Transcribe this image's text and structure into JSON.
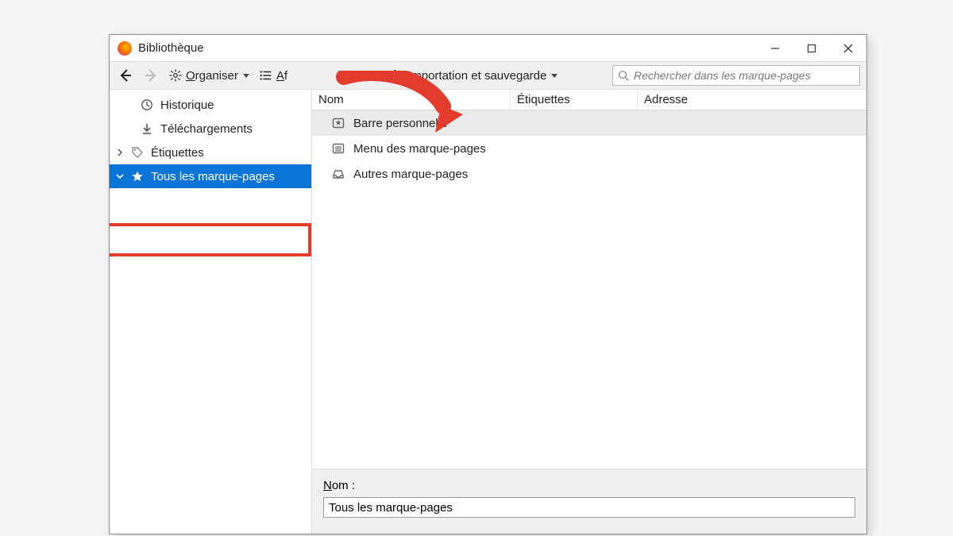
{
  "window": {
    "title": "Bibliothèque"
  },
  "toolbar": {
    "organize_label": "Organiser",
    "organize_prefix_underline": "O",
    "views_label": "Af",
    "views_prefix_underline": "A",
    "import_label": "Importation et sauvegarde",
    "import_prefix_underline": "I"
  },
  "search": {
    "placeholder": "Rechercher dans les marque-pages"
  },
  "sidebar": {
    "items": [
      {
        "label": "Historique",
        "icon": "clock-icon"
      },
      {
        "label": "Téléchargements",
        "icon": "download-icon"
      },
      {
        "label": "Étiquettes",
        "icon": "tag-icon",
        "expandable": true
      },
      {
        "label": "Tous les marque-pages",
        "icon": "star-icon",
        "selected": true,
        "expanded": true
      }
    ]
  },
  "columns": {
    "name": "Nom",
    "tags": "Étiquettes",
    "address": "Adresse"
  },
  "rows": [
    {
      "label": "Barre personnelle",
      "icon": "bookmark-toolbar-icon",
      "selected": true
    },
    {
      "label": "Menu des marque-pages",
      "icon": "menu-list-icon"
    },
    {
      "label": "Autres marque-pages",
      "icon": "inbox-icon"
    }
  ],
  "detail": {
    "name_label_underline": "N",
    "name_label_rest": "om :",
    "name_value": "Tous les marque-pages"
  },
  "annotation": {
    "color": "#e33b2e"
  }
}
